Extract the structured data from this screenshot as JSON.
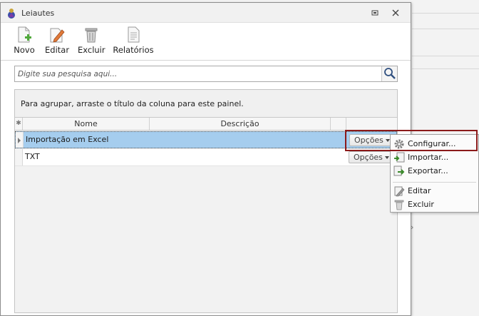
{
  "window": {
    "title": "Leiautes",
    "icons": {
      "app": "app-logo-icon",
      "restore": "restore-icon",
      "close": "close-icon"
    }
  },
  "toolbar": {
    "items": [
      {
        "label": "Novo",
        "icon": "new-document-icon"
      },
      {
        "label": "Editar",
        "icon": "edit-pencil-icon"
      },
      {
        "label": "Excluir",
        "icon": "trash-icon"
      },
      {
        "label": "Relatórios",
        "icon": "report-icon"
      }
    ]
  },
  "search": {
    "placeholder": "Digite sua pesquisa aqui...",
    "value": "",
    "icon": "search-icon"
  },
  "grid": {
    "group_panel_text": "Para agrupar, arraste o título da coluna para este painel.",
    "columns": [
      "Nome",
      "Descrição"
    ],
    "options_label": "Opções",
    "rows": [
      {
        "name": "Importação em Excel",
        "description": "",
        "selected": true
      },
      {
        "name": "TXT",
        "description": "",
        "selected": false
      }
    ]
  },
  "context_menu": {
    "items": [
      {
        "label": "Configurar...",
        "icon": "gear-icon"
      },
      {
        "label": "Importar...",
        "icon": "import-icon"
      },
      {
        "label": "Exportar...",
        "icon": "export-icon"
      },
      {
        "label": "Editar",
        "icon": "edit-icon"
      },
      {
        "label": "Excluir",
        "icon": "trash-icon"
      }
    ]
  },
  "colors": {
    "selection": "#a5cdee",
    "highlight_border": "#8b1a1a",
    "accent_green": "#4fa83a"
  }
}
